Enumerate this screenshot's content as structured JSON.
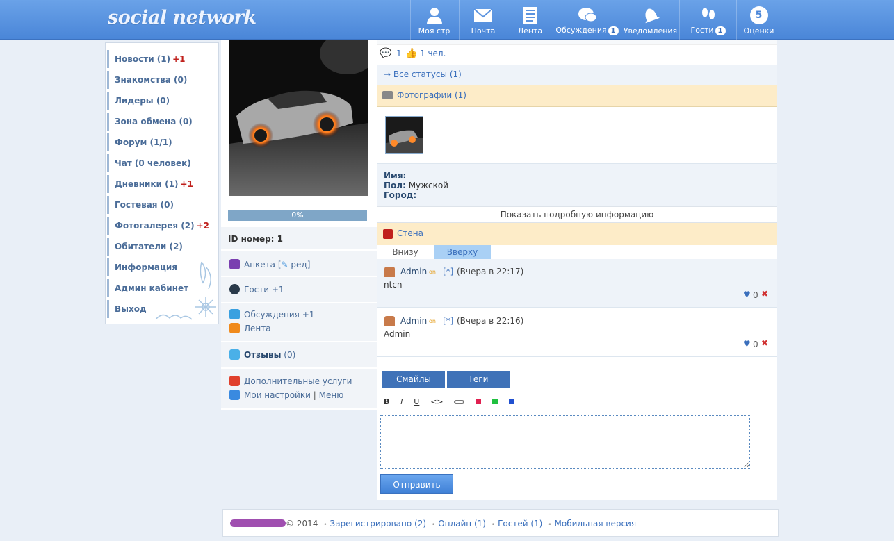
{
  "brand": {
    "logo_text": "social network"
  },
  "topnav": [
    {
      "label": "Моя стр",
      "icon": "user-icon"
    },
    {
      "label": "Почта",
      "icon": "mail-icon"
    },
    {
      "label": "Лента",
      "icon": "feed-icon"
    },
    {
      "label": "Обсуждения",
      "icon": "chat-icon",
      "badge": "1"
    },
    {
      "label": "Уведомления",
      "icon": "bell-icon"
    },
    {
      "label": "Гости",
      "icon": "footprints-icon",
      "badge": "1"
    },
    {
      "label": "Оценки",
      "icon": "rating-icon",
      "badge_value": "5"
    }
  ],
  "sidebar": {
    "items": [
      {
        "label": "Новости (1)",
        "plus": "+1"
      },
      {
        "label": "Знакомства (0)",
        "plus": ""
      },
      {
        "label": "Лидеры (0)",
        "plus": ""
      },
      {
        "label": "Зона обмена (0)",
        "plus": ""
      },
      {
        "label": "Форум (1/1)",
        "plus": ""
      },
      {
        "label": "Чат (0 человек)",
        "plus": ""
      },
      {
        "label": "Дневники (1)",
        "plus": "+1"
      },
      {
        "label": "Гостевая (0)",
        "plus": ""
      },
      {
        "label": "Фотогалерея (2)",
        "plus": "+2"
      },
      {
        "label": "Обитатели (2)",
        "plus": ""
      },
      {
        "label": "Информация",
        "plus": ""
      },
      {
        "label": "Админ кабинет",
        "plus": ""
      },
      {
        "label": "Выход",
        "plus": ""
      }
    ]
  },
  "profile": {
    "progress_text": "0%",
    "progress_value": 0,
    "id_label": "ID номер:",
    "id_value": "1",
    "anketa_label": "Анкета [",
    "anketa_edit": "ред]",
    "guests_label": "Гости",
    "guests_plus": "+1",
    "discussions_label": "Обсуждения",
    "discussions_plus": "+1",
    "feed_label": "Лента",
    "reviews_label": "Отзывы",
    "reviews_count": "(0)",
    "services_label": "Дополнительные услуги",
    "settings_label": "Мои настройки",
    "separator": "|",
    "menu_label": "Меню"
  },
  "main": {
    "status_comments": "1",
    "status_likes": "1 чел.",
    "all_statuses": "→ Все статусы (1)",
    "photos_header": "Фотографии (1)",
    "info": {
      "name_label": "Имя:",
      "gender_label": "Пол:",
      "gender_value": "Мужской",
      "city_label": "Город:"
    },
    "show_details": "Показать подробную информацию",
    "wall_header": "Стена",
    "tabs": [
      "Внизу",
      "Вверху"
    ],
    "posts": [
      {
        "author": "Admin",
        "online": "on",
        "star": "[*]",
        "time": "(Вчера в 22:17)",
        "text": "ntcn",
        "likes": "0"
      },
      {
        "author": "Admin",
        "online": "on",
        "star": "[*]",
        "time": "(Вчера в 22:16)",
        "text": "Admin",
        "likes": "0"
      }
    ],
    "smiles_button": "Смайлы",
    "tags_button": "Теги",
    "toolbar": {
      "bold": "B",
      "italic": "I",
      "underline": "U",
      "code": "<>"
    },
    "submit_button": "Отправить"
  },
  "footer": {
    "copyright": "© 2014",
    "registered": "Зарегистрировано (2)",
    "online": "Онлайн (1)",
    "guests": "Гостей (1)",
    "mobile": "Мобильная версия"
  },
  "colors": {
    "accent": "#4a86d8",
    "plus": "#c0201c",
    "link": "#3a6fbc",
    "highlight": "#fdecc8"
  }
}
